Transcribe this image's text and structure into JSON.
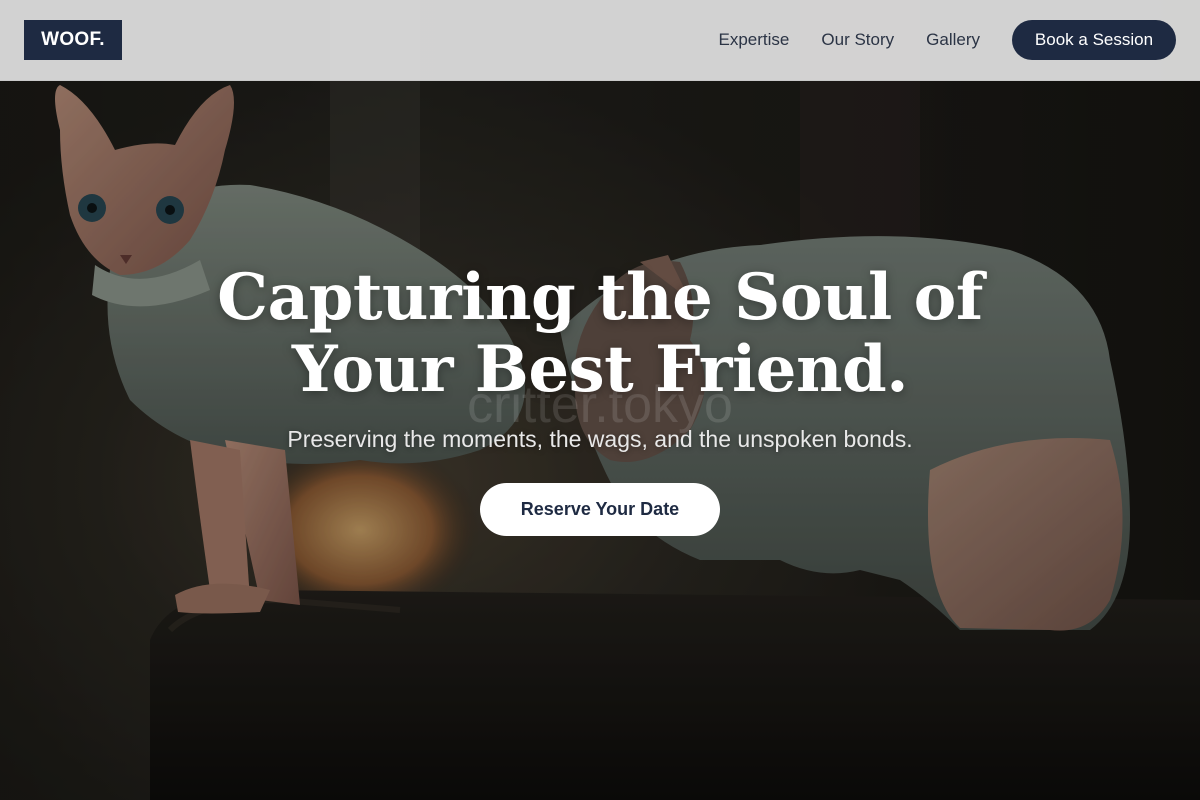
{
  "brand": {
    "logo_text": "WOOF."
  },
  "nav": {
    "links": [
      {
        "label": "Expertise"
      },
      {
        "label": "Our Story"
      },
      {
        "label": "Gallery"
      }
    ],
    "cta_label": "Book a Session"
  },
  "hero": {
    "title_line_1": "Capturing the Soul of",
    "title_line_2": "Your Best Friend.",
    "subtitle": "Preserving the moments, the wags, and the unspoken bonds.",
    "cta_label": "Reserve Your Date",
    "watermark": "critter.tokyo",
    "image_subject": "two hairless sphynx cats wearing grey fleece sweaters"
  },
  "colors": {
    "brand_navy": "#1e2a42",
    "header_bg": "#e1e1e1",
    "cta_bg": "#ffffff"
  }
}
